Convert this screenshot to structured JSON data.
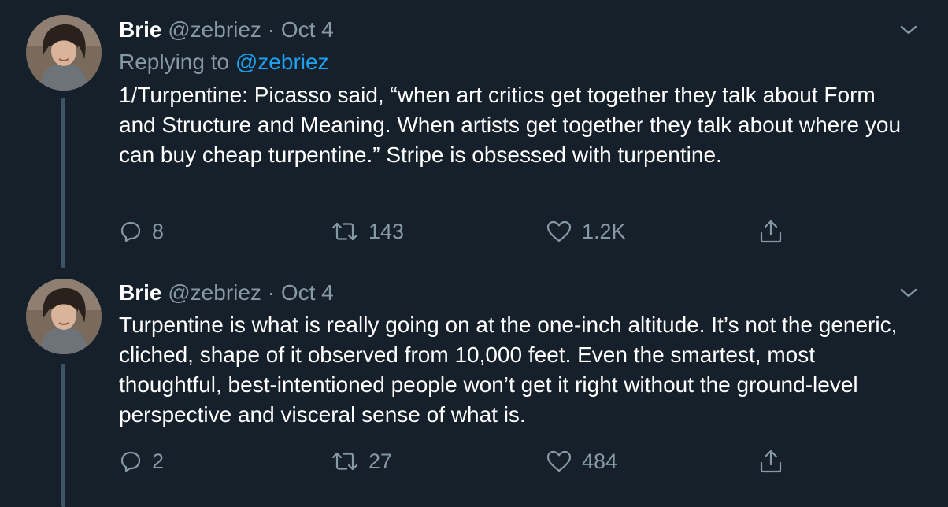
{
  "tweets": [
    {
      "author_name": "Brie",
      "handle": "@zebriez",
      "separator": "·",
      "date": "Oct 4",
      "replying_prefix": "Replying to",
      "replying_handle": "@zebriez",
      "text": "1/Turpentine: Picasso said, “when art critics get together they talk about Form and Structure and Meaning. When artists get together they talk about where you can buy cheap turpentine.” Stripe is obsessed with turpentine.",
      "reply_count": "8",
      "retweet_count": "143",
      "like_count": "1.2K"
    },
    {
      "author_name": "Brie",
      "handle": "@zebriez",
      "separator": "·",
      "date": "Oct 4",
      "text": "Turpentine is what is really going on at the one-inch altitude. It’s not the generic, cliched, shape of it observed from 10,000 feet. Even the smartest, most thoughtful, best-intentioned people won’t get it right without the ground-level perspective and visceral sense of what is.",
      "reply_count": "2",
      "retweet_count": "27",
      "like_count": "484"
    }
  ],
  "icons": {
    "reply": "reply-icon",
    "retweet": "retweet-icon",
    "like": "heart-icon",
    "share": "share-icon",
    "more": "chevron-down-icon"
  },
  "colors": {
    "background": "#15202b",
    "secondary_text": "#8899a6",
    "link": "#1da1f2",
    "thread_line": "#3d5466"
  }
}
